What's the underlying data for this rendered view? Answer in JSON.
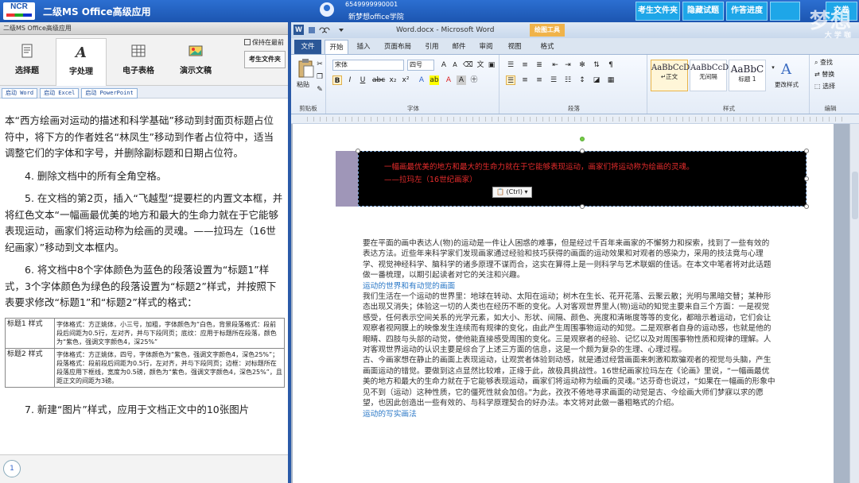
{
  "app": {
    "logo_text": "NCR",
    "title": "二级MS Office高级应用",
    "user_id": "6549999990001",
    "school": "新梦想office学院",
    "buttons": [
      "考生文件夹",
      "隐藏试题",
      "作答进度",
      "交卷"
    ]
  },
  "left_panel": {
    "window_title": "二级MS Office高级应用",
    "tabs": [
      {
        "label": "选择题",
        "icon": "document-icon"
      },
      {
        "label": "字处理",
        "icon": "letter-a-icon"
      },
      {
        "label": "电子表格",
        "icon": "spreadsheet-grid-icon"
      },
      {
        "label": "演示文稿",
        "icon": "picture-icon"
      }
    ],
    "always_on_top": "保持在最前",
    "folder_button": "考生文件夹",
    "launch_buttons": [
      "启动 Word",
      "启动 Excel",
      "启动 PowerPoint"
    ],
    "task_paragraphs": [
      "本“西方绘画对运动的描述和科学基础”移动到封面页标题占位符中，将下方的作者姓名“林凤生”移动到作者占位符中，适当调整它们的字体和字号，并删除副标题和日期占位符。",
      "4.  删除文档中的所有全角空格。",
      "5.  在文档的第2页，插入“飞越型”提要栏的内置文本框，并将红色文本“一幅画最优美的地方和最大的生命力就在于它能够表现运动，画家们将运动称为绘画的灵魂。——拉玛左（16世纪画家）”移动到文本框内。",
      "6.  将文档中8个字体颜色为蓝色的段落设置为“标题1”样式，3个字体颜色为绿色的段落设置为“标题2”样式，并按照下表要求修改“标题1”和“标题2”样式的格式："
    ],
    "table": [
      {
        "name": "标题1 样式",
        "spec": "字体格式：方正姚体，小三号，加粗，字体颜色为“白色，背景段落格式：段前段后间距为0.5行，左对齐，并与下段同页；底纹：应用于标题所在段落，颜色为“紫色，强调文字颜色4，深25%”"
      },
      {
        "name": "标题2 样式",
        "spec": "字体格式：方正姚体，四号，字体颜色为“紫色，强调文字颜色4，深色25%”；段落格式：段前段后间距为0.5行，左对齐，并与下段同页；边框：对标题所在段落应用下框线，宽度为0.5磅，颜色为“紫色，强调文字颜色4，深色25%”，且距正文的间距为3磅。"
      }
    ],
    "cut_line": "7.  新建“图片”样式，应用于文档正文中的10张图片",
    "page_number": "1"
  },
  "word": {
    "title": "Word.docx - Microsoft Word",
    "tools_tab": "绘图工具",
    "tabs": [
      "文件",
      "开始",
      "插入",
      "页面布局",
      "引用",
      "邮件",
      "审阅",
      "视图",
      "格式"
    ],
    "active_tab": "开始",
    "font_name": "宋体",
    "font_size": "四号",
    "groups": [
      "剪贴板",
      "字体",
      "段落",
      "样式",
      "编辑"
    ],
    "paste_label": "粘贴",
    "styles": [
      {
        "preview": "AaBbCcD",
        "name": "↵正文"
      },
      {
        "preview": "AaBbCcD",
        "name": "无间隔"
      },
      {
        "preview": "AaBbC",
        "name": "标题 1"
      }
    ],
    "change_styles": "更改样式",
    "editing": [
      "查找",
      "替换",
      "选择"
    ],
    "textbox_lines": [
      "一幅画最优美的地方和最大的生命力就在于它能够表现运动，画家们将运动称为绘画的灵魂。",
      "——拉玛左（16世纪画家）"
    ],
    "paste_options": "(Ctrl)",
    "body": [
      {
        "type": "p",
        "text": "要在平面的画中表达人(物)的运动是一件让人困惑的难事，但是经过千百年来画家的不懈努力和探索，找到了一些有效的表达方法。近些年来科学家们发现画家通过经验和技巧获得的画面的运动效果和对观者的感染力，采用的技法竟与心理学、视觉神经科学、脑科学的诸多原理不谋而合，这实在算得上是一则科学与艺术联姻的佳话。在本文中笔者将对此话题做一番梳理，以期引起读者对它的关注和兴趣。"
      },
      {
        "type": "h",
        "text": "运动的世界和有动觉的画面"
      },
      {
        "type": "p",
        "text": "我们生活在一个运动的世界里：地球在转动、太阳在运动；树木在生长、花开花落、云聚云散；光明与黑暗交替；某种形态出现又消失；体验这一切的人类也在经历不断的变化。人对客观世界里人(物)运动的知觉主要来自三个方面：一是视觉感受，任何表示空间关系的光学元素，如大小、形状、间隔、颜色、亮度和清晰度等等的变化，都暗示着运动，它们会让观察者视网膜上的映像发生连续而有规律的变化，由此产生周围事物运动的知觉。二是观察者自身的运动感，也就是他的眼睛、四肢与头部的动觉，使他能直接感受周围的变化。三是观察者的经验、记忆以及对周围事物性质和规律的理解。人对客观世界运动的认识主要是综合了上述三方面的信息，这是一个颇为复杂的生理、心理过程。"
      },
      {
        "type": "p",
        "text": "古、今画家想在静止的画面上表现运动，让观赏者体验到动感，就是通过经营画面来刺激和欺骗观者的视觉与头脑，产生画面运动的错觉。要做到这点显然比较难，正缘于此，故极具挑战性。16世纪画家拉玛左在《论画》里说，“一幅画最优美的地方和最大的生命力就在于它能够表现运动，画家们将运动称为绘画的灵魂。”达芬奇也说过，“如果在一幅画的形象中见不到（运动）这种性质，它的僵死性就会加倍。”为此，孜孜不倦地寻求画面的动觉是古、今绘画大师们梦寐以求的愿望，也因此创造出一些有效的、与科学原理契合的好办法。本文将对此做一番粗略式的介绍。"
      },
      {
        "type": "h",
        "text": "运动的写实画法"
      }
    ]
  },
  "watermark": {
    "big": "梦想",
    "small": "大 学 咖"
  }
}
